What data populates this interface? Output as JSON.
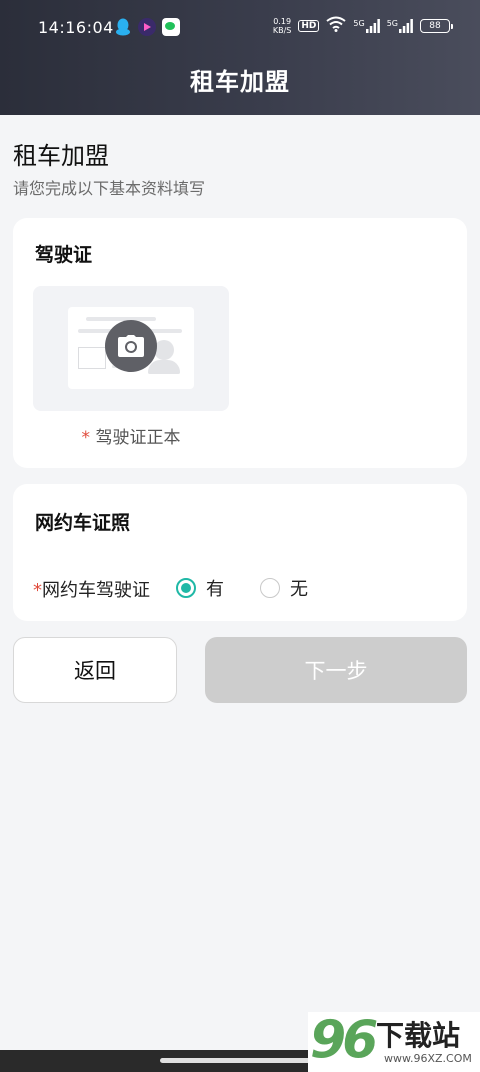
{
  "status_bar": {
    "time": "14:16:04",
    "net_speed_value": "0.19",
    "net_speed_unit": "KB/S",
    "hd_label": "HD",
    "signal1_label": "5G",
    "signal2_label": "5G",
    "battery": "88"
  },
  "header": {
    "title": "租车加盟"
  },
  "intro": {
    "title": "租车加盟",
    "subtitle": "请您完成以下基本资料填写"
  },
  "license_card": {
    "title": "驾驶证",
    "upload_required_mark": "*",
    "upload_caption": "驾驶证正本"
  },
  "online_card": {
    "title": "网约车证照",
    "field_required_mark": "*",
    "field_label": "网约车驾驶证",
    "options": [
      {
        "label": "有",
        "selected": true
      },
      {
        "label": "无",
        "selected": false
      }
    ]
  },
  "actions": {
    "back_label": "返回",
    "next_label": "下一步"
  },
  "watermark": {
    "number": "96",
    "text": "下载站",
    "url": "www.96XZ.COM"
  },
  "colors": {
    "accent": "#1fb8a6",
    "required": "#e04b3c",
    "disabled_button": "#cdcdcd",
    "header_bg": "#2b2e3a"
  }
}
